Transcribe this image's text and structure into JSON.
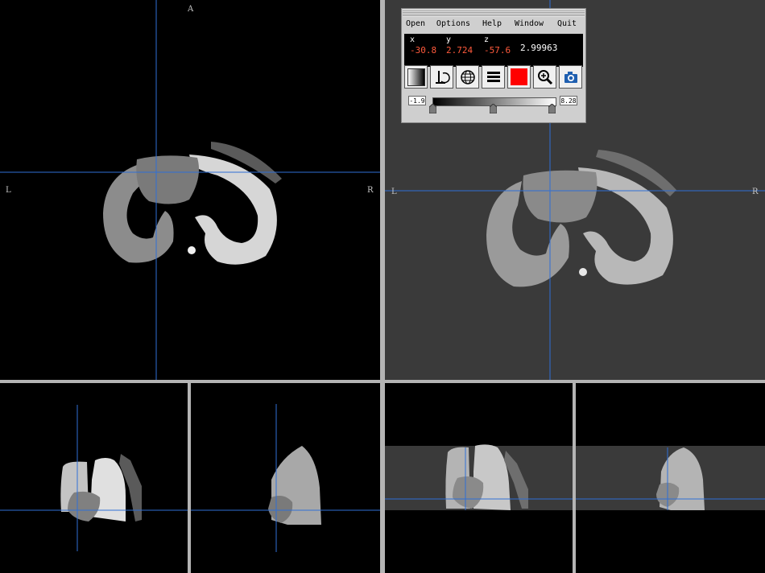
{
  "orientation": {
    "anterior": "A",
    "left": "L",
    "right": "R"
  },
  "menu": [
    "Open",
    "Options",
    "Help",
    "Window",
    "Quit"
  ],
  "coords": {
    "x_label": "x",
    "y_label": "y",
    "z_label": "z",
    "x_value": "-30.8",
    "y_value": "2.724",
    "z_value": "-57.6",
    "intensity": "2.99963"
  },
  "toolbar": {
    "icons": [
      "grayscale-gradient-icon",
      "orientation-reset-icon",
      "globe-icon",
      "layers-icon",
      "color-swatch-icon",
      "zoom-icon",
      "camera-icon"
    ],
    "swatch_color": "#ff0000"
  },
  "window_level": {
    "min": "-1.9",
    "max": "8.28"
  },
  "colors": {
    "crosshair": "#2f6fd6",
    "coord_value": "#ff5a3c",
    "overlay_bg": "#3a3a3a"
  }
}
